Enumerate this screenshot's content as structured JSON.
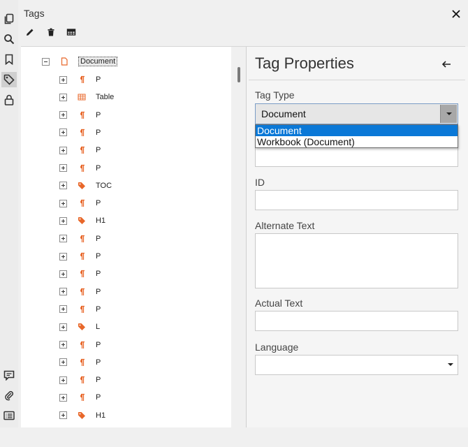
{
  "panel": {
    "title": "Tags",
    "toolbar": [
      "edit-icon",
      "delete-icon",
      "table-editor-icon"
    ]
  },
  "rail_icons": [
    "pages-icon",
    "search-icon",
    "bookmark-icon",
    "tag-icon",
    "lock-icon",
    "comment-icon",
    "attachment-icon",
    "content-list-icon"
  ],
  "tree": {
    "root": "Document",
    "items": [
      {
        "label": "P",
        "kind": "paragraph"
      },
      {
        "label": "Table",
        "kind": "table"
      },
      {
        "label": "P",
        "kind": "paragraph"
      },
      {
        "label": "P",
        "kind": "paragraph"
      },
      {
        "label": "P",
        "kind": "paragraph"
      },
      {
        "label": "P",
        "kind": "paragraph"
      },
      {
        "label": "TOC",
        "kind": "tag"
      },
      {
        "label": "P",
        "kind": "paragraph"
      },
      {
        "label": "H1",
        "kind": "tag"
      },
      {
        "label": "P",
        "kind": "paragraph"
      },
      {
        "label": "P",
        "kind": "paragraph"
      },
      {
        "label": "P",
        "kind": "paragraph"
      },
      {
        "label": "P",
        "kind": "paragraph"
      },
      {
        "label": "P",
        "kind": "paragraph"
      },
      {
        "label": "L",
        "kind": "tag"
      },
      {
        "label": "P",
        "kind": "paragraph"
      },
      {
        "label": "P",
        "kind": "paragraph"
      },
      {
        "label": "P",
        "kind": "paragraph"
      },
      {
        "label": "P",
        "kind": "paragraph"
      },
      {
        "label": "H1",
        "kind": "tag"
      }
    ]
  },
  "properties": {
    "title": "Tag Properties",
    "tag_type_label": "Tag Type",
    "tag_type_value": "Document",
    "tag_type_options": [
      "Document",
      "Workbook (Document)"
    ],
    "id_label": "ID",
    "alt_text_label": "Alternate Text",
    "actual_text_label": "Actual Text",
    "language_label": "Language"
  },
  "colors": {
    "accent": "#0a78d7",
    "icon_orange": "#e8672a"
  }
}
